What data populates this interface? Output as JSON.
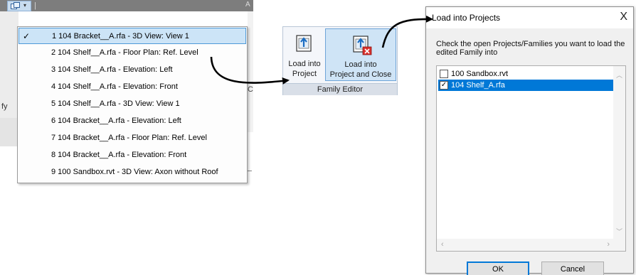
{
  "toolbar": {
    "switch_windows_icon": "switch-windows-icon",
    "dropdown_icon": "chevron-down-icon",
    "right_char": "A"
  },
  "background": {
    "left_fragment": "fy",
    "right_fragment": "C"
  },
  "window_menu": {
    "items": [
      {
        "label": "1 104 Bracket__A.rfa - 3D View: View 1",
        "checked": true
      },
      {
        "label": "2 104 Shelf__A.rfa - Floor Plan: Ref. Level",
        "checked": false
      },
      {
        "label": "3 104 Shelf__A.rfa - Elevation: Left",
        "checked": false
      },
      {
        "label": "4 104 Shelf__A.rfa - Elevation: Front",
        "checked": false
      },
      {
        "label": "5 104 Shelf__A.rfa - 3D View: View 1",
        "checked": false
      },
      {
        "label": "6 104 Bracket__A.rfa - Elevation: Left",
        "checked": false
      },
      {
        "label": "7 104 Bracket__A.rfa - Floor Plan: Ref. Level",
        "checked": false
      },
      {
        "label": "8 104 Bracket__A.rfa - Elevation: Front",
        "checked": false
      },
      {
        "label": "9 100 Sandbox.rvt - 3D View: Axon without Roof",
        "checked": false
      }
    ],
    "check_glyph": "✓"
  },
  "family_editor": {
    "panel_title": "Family Editor",
    "load_into_project": {
      "line1": "Load into",
      "line2": "Project"
    },
    "load_into_project_close": {
      "line1": "Load into",
      "line2": "Project and Close"
    }
  },
  "dialog": {
    "title": "Load into Projects",
    "close_glyph": "X",
    "instruction": "Check the open Projects/Families you want to load the edited Family into",
    "items": [
      {
        "label": "100 Sandbox.rvt",
        "checked": false,
        "selected": false
      },
      {
        "label": "104 Shelf_A.rfa",
        "checked": true,
        "selected": true
      }
    ],
    "ok_label": "OK",
    "cancel_label": "Cancel"
  },
  "colors": {
    "menu_highlight": "#cce4f7",
    "selection_blue": "#0078d7",
    "ribbon_active": "#cfe4f6"
  }
}
